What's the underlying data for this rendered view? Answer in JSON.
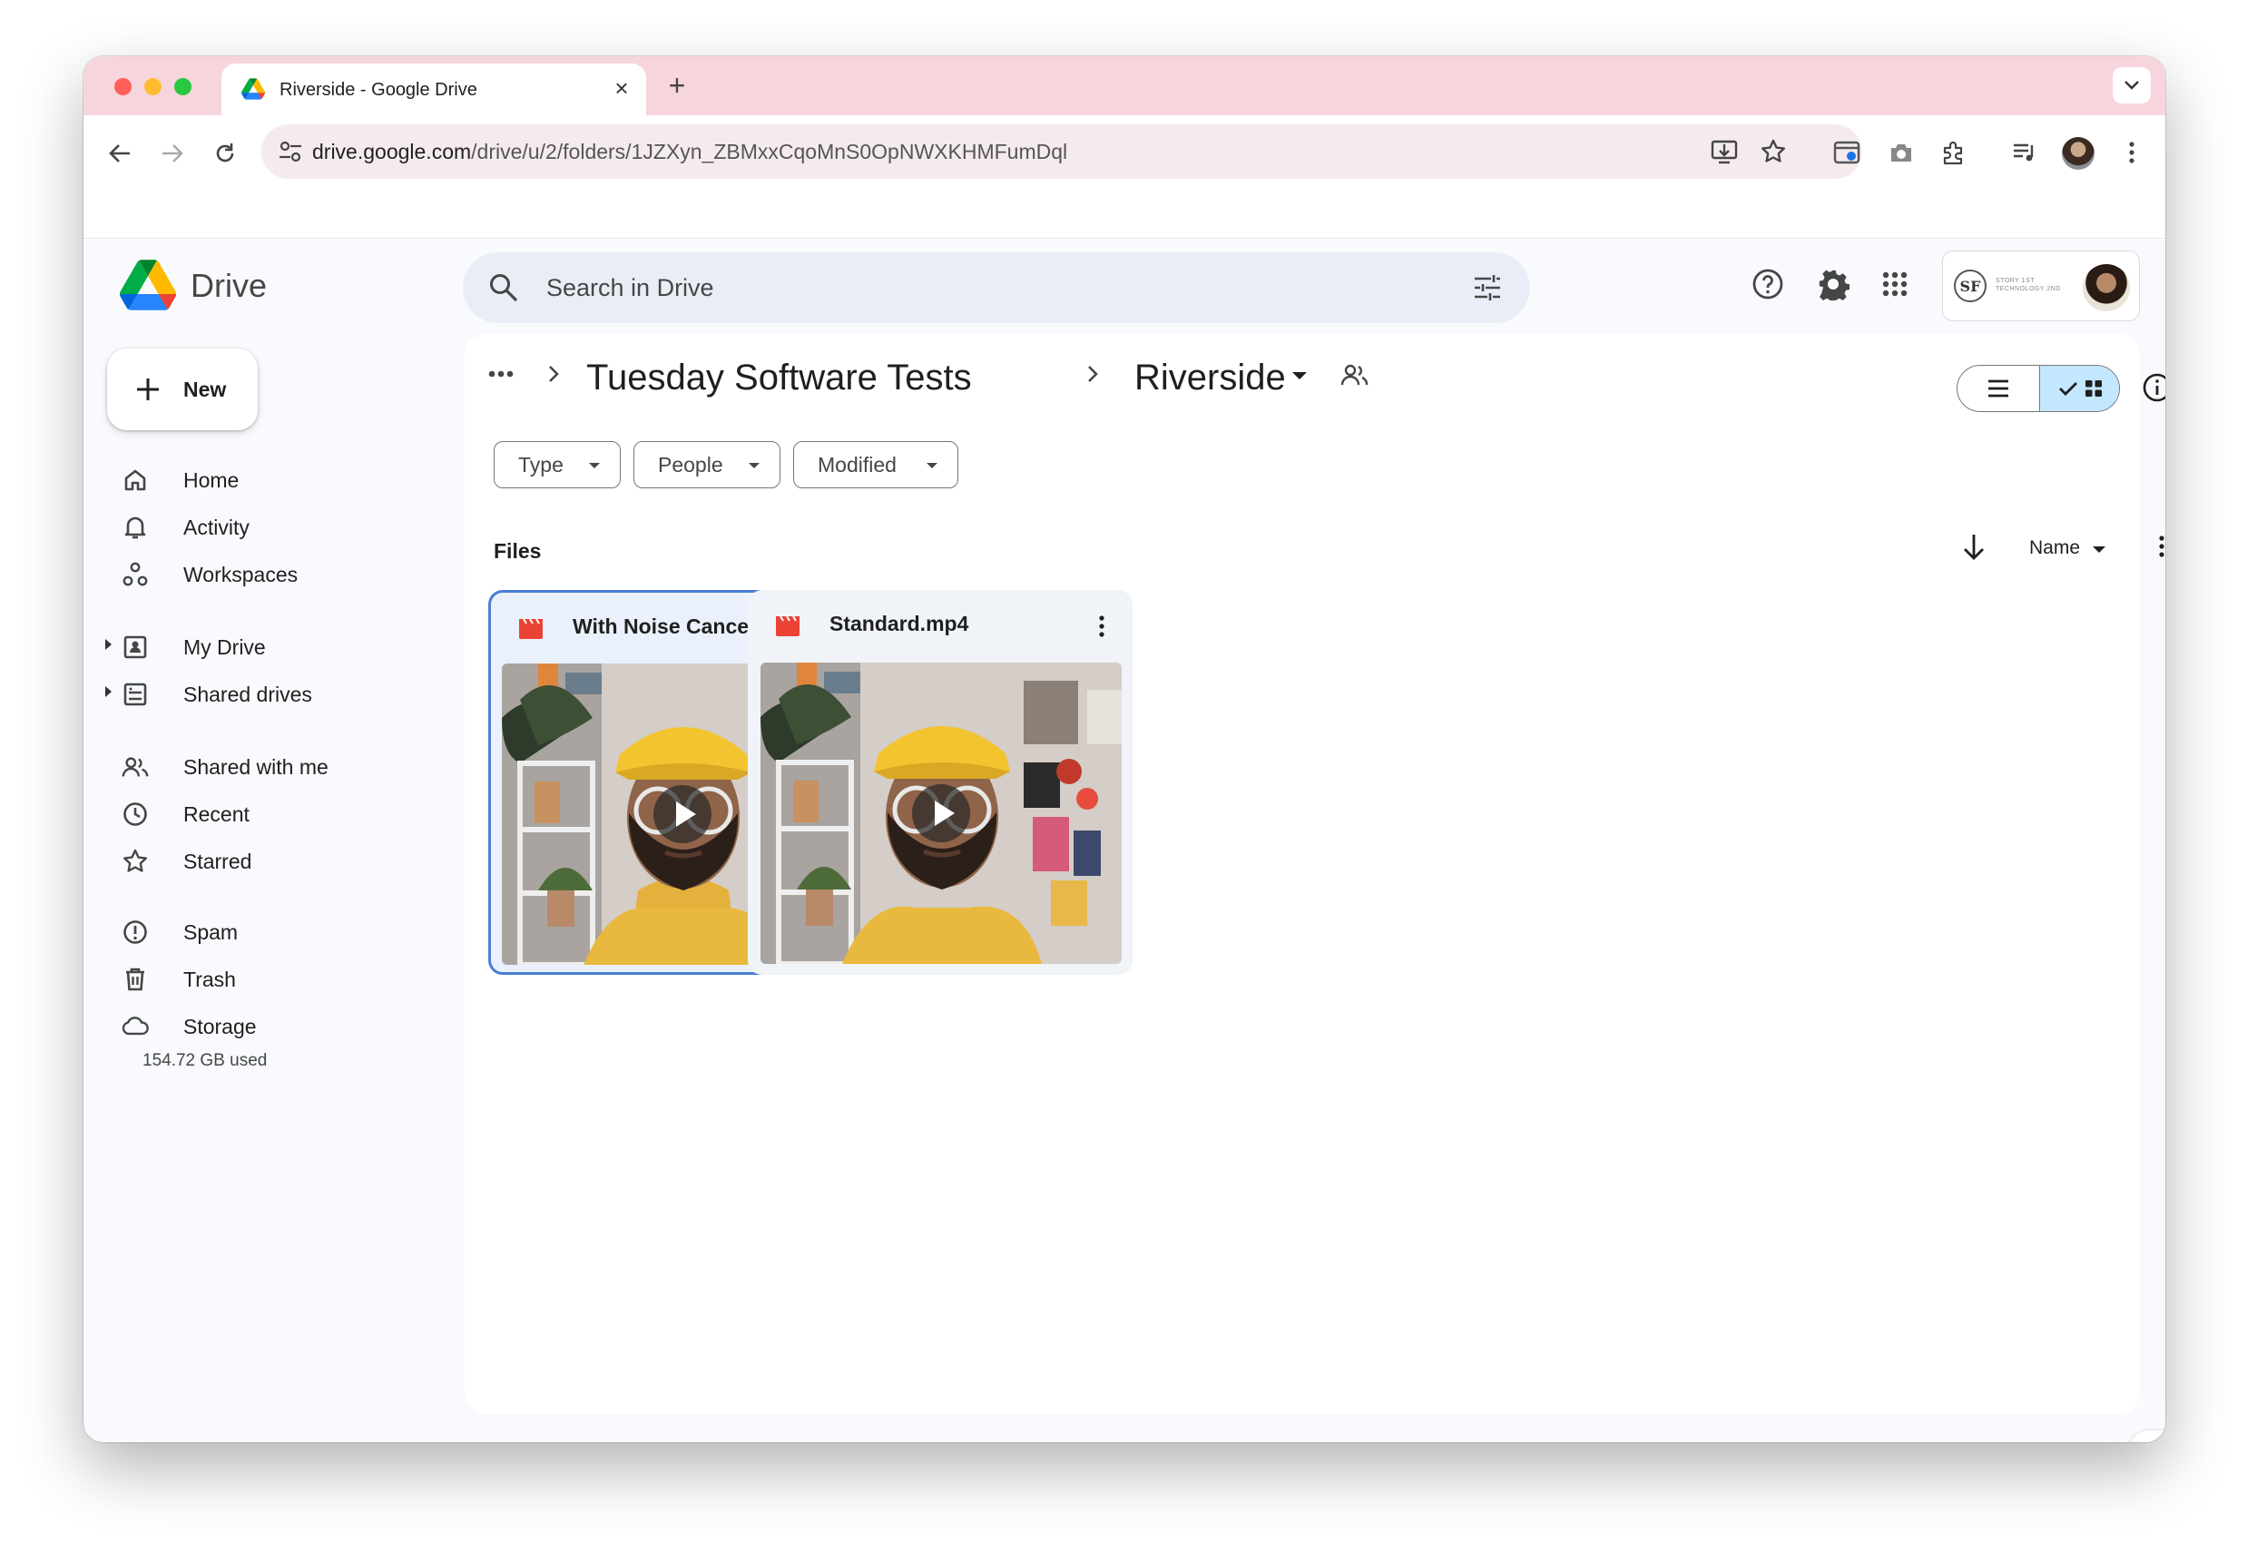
{
  "browser": {
    "tab_title": "Riverside - Google Drive",
    "url_host": "drive.google.com",
    "url_path": "/drive/u/2/folders/1JZXyn_ZBMxxCqoMnS0OpNWXKHMFumDql"
  },
  "app": {
    "name": "Drive",
    "search_placeholder": "Search in Drive",
    "new_label": "New",
    "org_text": "Story 1st Technology 2nd"
  },
  "sidebar": {
    "items": [
      {
        "label": "Home",
        "icon": "home-icon"
      },
      {
        "label": "Activity",
        "icon": "bell-icon"
      },
      {
        "label": "Workspaces",
        "icon": "workspaces-icon"
      },
      {
        "label": "My Drive",
        "icon": "my-drive-icon"
      },
      {
        "label": "Shared drives",
        "icon": "shared-drives-icon"
      },
      {
        "label": "Shared with me",
        "icon": "people-icon"
      },
      {
        "label": "Recent",
        "icon": "clock-icon"
      },
      {
        "label": "Starred",
        "icon": "star-icon"
      },
      {
        "label": "Spam",
        "icon": "spam-icon"
      },
      {
        "label": "Trash",
        "icon": "trash-icon"
      },
      {
        "label": "Storage",
        "icon": "cloud-icon"
      }
    ],
    "storage_used": "154.72 GB used"
  },
  "breadcrumb": {
    "parent": "Tuesday Software Tests",
    "current": "Riverside"
  },
  "filters": {
    "type": "Type",
    "people": "People",
    "modified": "Modified"
  },
  "files": {
    "section_label": "Files",
    "sort_label": "Name",
    "items": [
      {
        "name": "With Noise Cancellati...",
        "selected": true
      },
      {
        "name": "Standard.mp4",
        "selected": false
      }
    ]
  },
  "colors": {
    "tabstrip": "#f7d5dd",
    "app_background": "#f8fafd",
    "search_background": "#e9eef6",
    "selected_view": "#c2e7ff",
    "selected_card_border": "#4a7fd3",
    "video_icon": "#ea4335"
  }
}
